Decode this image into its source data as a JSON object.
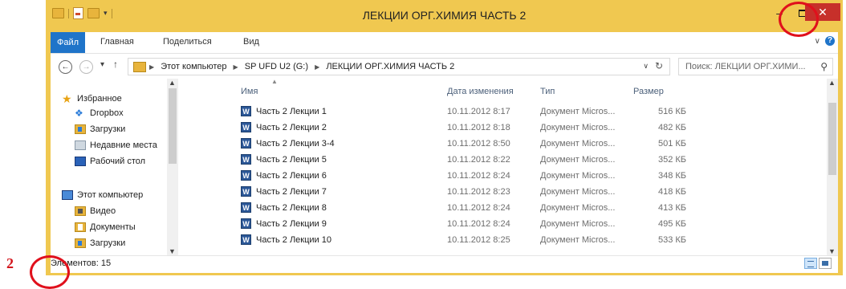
{
  "window": {
    "title": "ЛЕКЦИИ ОРГ.ХИМИЯ ЧАСТЬ 2",
    "frame_color": "#f0c850",
    "buttons": {
      "minimize": "–",
      "close": "✕"
    }
  },
  "ribbon": {
    "tabs": [
      "Файл",
      "Главная",
      "Поделиться",
      "Вид"
    ],
    "file_tab_color": "#1f74c9",
    "help": "?"
  },
  "address": {
    "crumbs": [
      "Этот компьютер",
      "SP UFD U2 (G:)",
      "ЛЕКЦИИ ОРГ.ХИМИЯ ЧАСТЬ 2"
    ],
    "search_placeholder": "Поиск: ЛЕКЦИИ ОРГ.ХИМИ..."
  },
  "nav": {
    "favorites": "Избранное",
    "fav_items": [
      "Dropbox",
      "Загрузки",
      "Недавние места",
      "Рабочий стол"
    ],
    "computer": "Этот компьютер",
    "comp_items": [
      "Видео",
      "Документы",
      "Загрузки"
    ]
  },
  "columns": {
    "name": "Имя",
    "date": "Дата изменения",
    "type": "Тип",
    "size": "Размер"
  },
  "files": [
    {
      "name": "Часть 2 Лекции 1",
      "date": "10.11.2012 8:17",
      "type": "Документ Micros...",
      "size": "516 КБ"
    },
    {
      "name": "Часть 2 Лекции 2",
      "date": "10.11.2012 8:18",
      "type": "Документ Micros...",
      "size": "482 КБ"
    },
    {
      "name": "Часть 2 Лекции 3-4",
      "date": "10.11.2012 8:50",
      "type": "Документ Micros...",
      "size": "501 КБ"
    },
    {
      "name": "Часть 2 Лекции 5",
      "date": "10.11.2012 8:22",
      "type": "Документ Micros...",
      "size": "352 КБ"
    },
    {
      "name": "Часть 2 Лекции 6",
      "date": "10.11.2012 8:24",
      "type": "Документ Micros...",
      "size": "348 КБ"
    },
    {
      "name": "Часть 2 Лекции 7",
      "date": "10.11.2012 8:23",
      "type": "Документ Micros...",
      "size": "418 КБ"
    },
    {
      "name": "Часть 2 Лекции 8",
      "date": "10.11.2012 8:24",
      "type": "Документ Micros...",
      "size": "413 КБ"
    },
    {
      "name": "Часть 2 Лекции 9",
      "date": "10.11.2012 8:24",
      "type": "Документ Micros...",
      "size": "495 КБ"
    },
    {
      "name": "Часть 2 Лекции 10",
      "date": "10.11.2012 8:25",
      "type": "Документ Micros...",
      "size": "533 КБ"
    }
  ],
  "status": {
    "count": "Элементов: 15"
  },
  "annotation": {
    "label": "2",
    "color": "#e0101c"
  }
}
